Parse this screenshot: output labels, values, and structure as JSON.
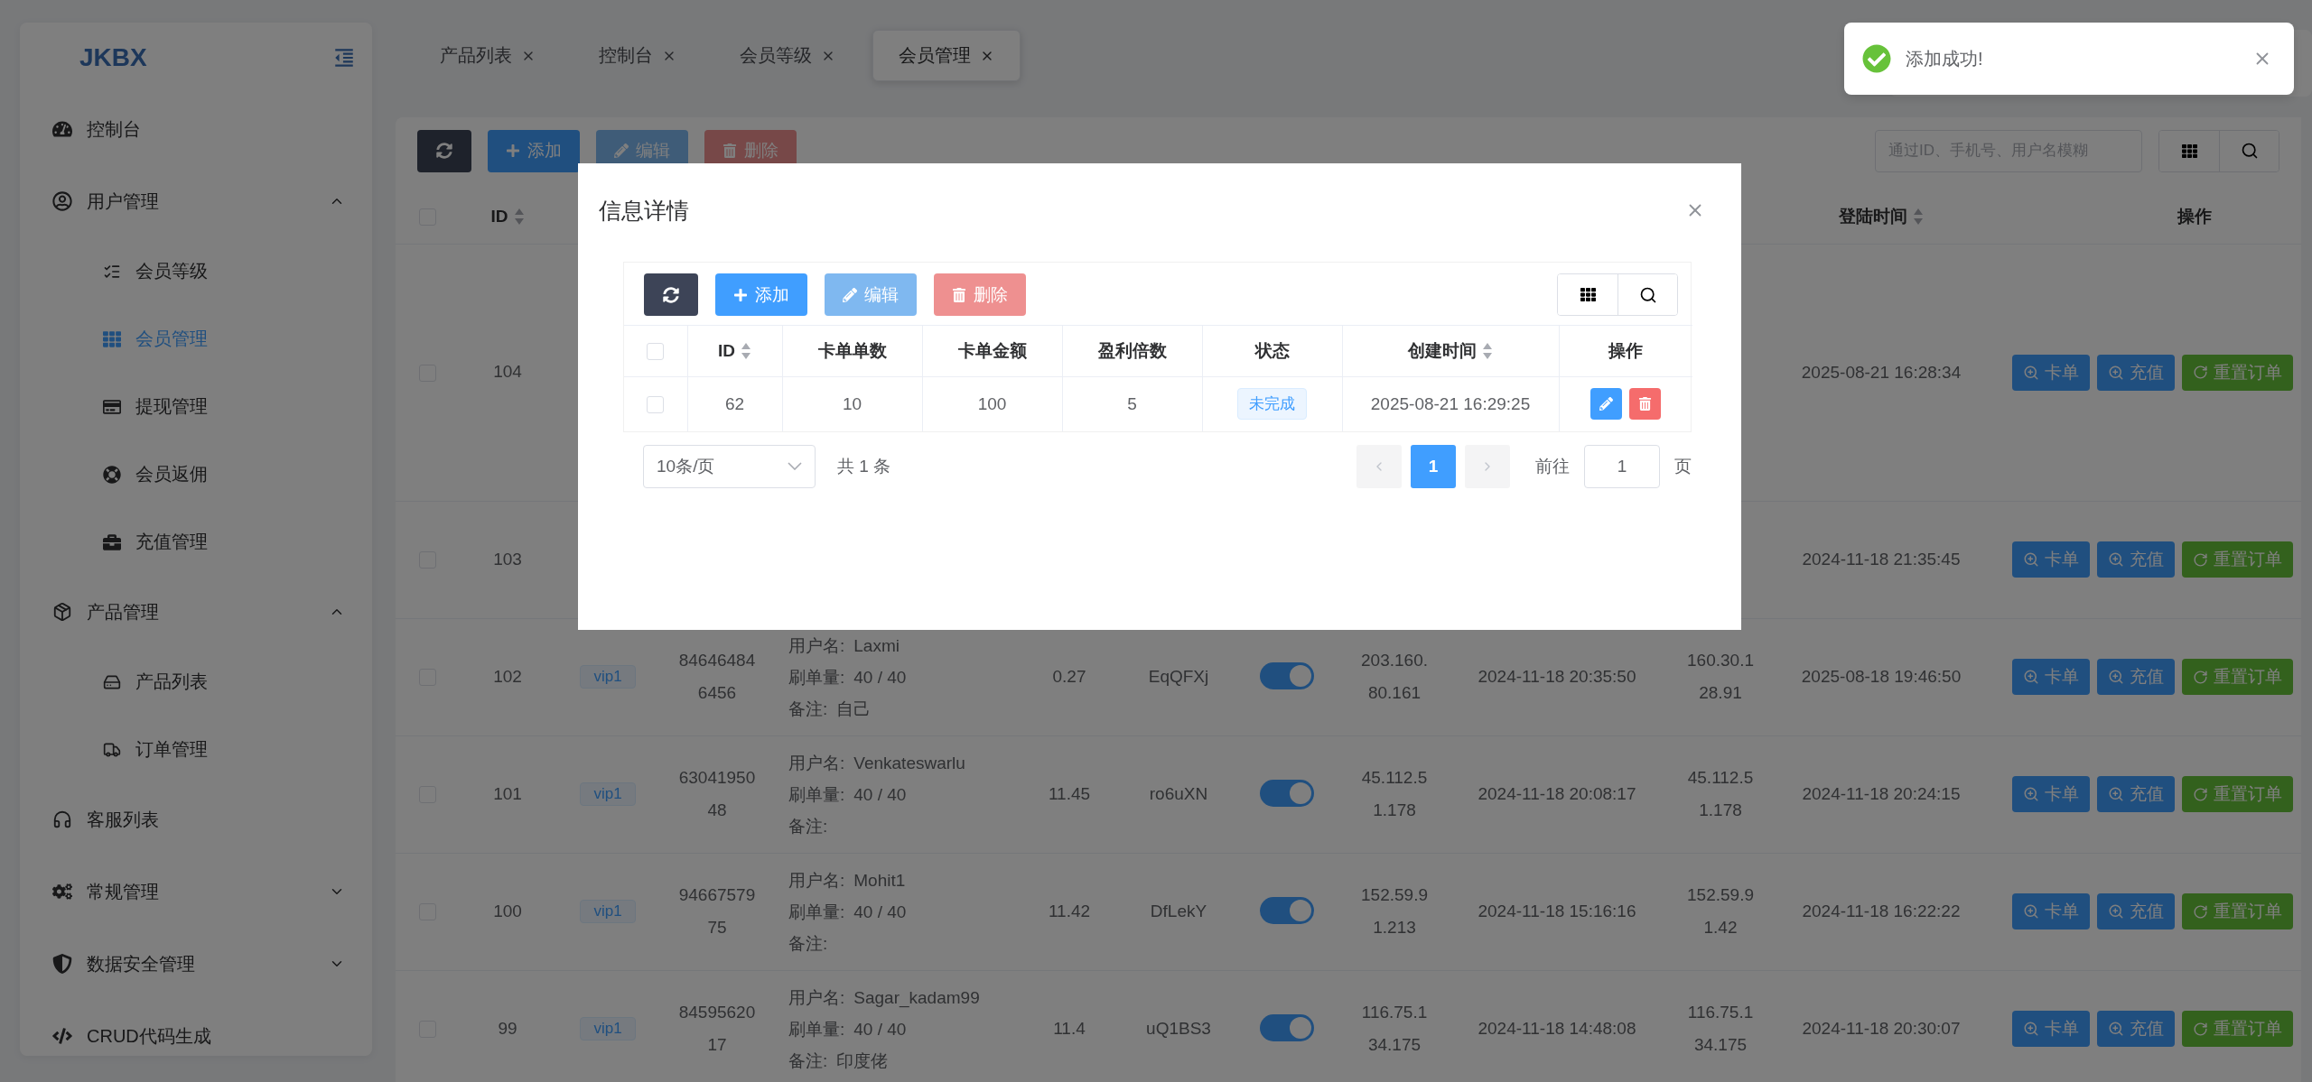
{
  "sidebar": {
    "logo": "JKBX",
    "menu": [
      {
        "label": "控制台",
        "selected": false
      },
      {
        "label": "用户管理",
        "expanded": true,
        "children": [
          {
            "label": "会员等级",
            "selected": false
          },
          {
            "label": "会员管理",
            "selected": true
          },
          {
            "label": "提现管理",
            "selected": false
          },
          {
            "label": "会员返佣",
            "selected": false
          },
          {
            "label": "充值管理",
            "selected": false
          }
        ]
      },
      {
        "label": "产品管理",
        "expanded": true,
        "children": [
          {
            "label": "产品列表",
            "selected": false
          },
          {
            "label": "订单管理",
            "selected": false
          }
        ]
      },
      {
        "label": "客服列表",
        "selected": false
      },
      {
        "label": "常规管理",
        "expanded": false
      },
      {
        "label": "数据安全管理",
        "expanded": false
      },
      {
        "label": "CRUD代码生成",
        "selected": false
      }
    ]
  },
  "tabs": [
    {
      "label": "产品列表",
      "selected": false
    },
    {
      "label": "控制台",
      "selected": false
    },
    {
      "label": "会员等级",
      "selected": false
    },
    {
      "label": "会员管理",
      "selected": true
    }
  ],
  "toolbar": {
    "buttons": [
      {
        "kind": "refresh",
        "disabled": false
      },
      {
        "kind": "add",
        "label": "添加",
        "disabled": false
      },
      {
        "kind": "edit",
        "label": "编辑",
        "disabled": true
      },
      {
        "kind": "delete",
        "label": "删除",
        "disabled": true
      }
    ],
    "search": {
      "placeholder": "通过ID、手机号、用户名模糊"
    }
  },
  "table": {
    "all_checked": false,
    "headers": {
      "id": {
        "label": "ID",
        "sortable": true
      },
      "login_time": {
        "label": "登陆时间",
        "sortable": true
      },
      "actions": {
        "label": "操作",
        "sortable": false
      }
    },
    "rows": [
      {
        "checked": false,
        "id": "104",
        "login_time": "2025-08-21 16:28:34",
        "actions": [
          {
            "kind": "view",
            "label": "卡单"
          },
          {
            "kind": "view",
            "label": "充值"
          },
          {
            "kind": "reset",
            "label": "重置订单"
          }
        ]
      },
      {
        "checked": false,
        "id": "103",
        "login_time": "2024-11-18 21:35:45",
        "actions": [
          {
            "kind": "view",
            "label": "卡单"
          },
          {
            "kind": "view",
            "label": "充值"
          },
          {
            "kind": "reset",
            "label": "重置订单"
          }
        ]
      },
      {
        "checked": false,
        "id": "102",
        "level": "vip1",
        "phone": "846464846456",
        "user": [
          {
            "label": "用户名:",
            "value": "Laxmi"
          },
          {
            "label": "刷单量:",
            "value": "40 / 40"
          },
          {
            "label": "备注:",
            "value": "自己"
          }
        ],
        "balance": "0.27",
        "code": "EqQFXj",
        "enabled": true,
        "reg_ip": "203.160.80.161",
        "reg_time": "2024-11-18 20:35:50",
        "last_ip": "160.30.128.91",
        "login_time": "2025-08-18 19:46:50",
        "actions": [
          {
            "kind": "view",
            "label": "卡单"
          },
          {
            "kind": "view",
            "label": "充值"
          },
          {
            "kind": "reset",
            "label": "重置订单"
          }
        ]
      },
      {
        "checked": false,
        "id": "101",
        "level": "vip1",
        "phone": "6304195048",
        "user": [
          {
            "label": "用户名:",
            "value": "Venkateswarlu"
          },
          {
            "label": "刷单量:",
            "value": "40 / 40"
          },
          {
            "label": "备注:"
          }
        ],
        "balance": "11.45",
        "code": "ro6uXN",
        "enabled": true,
        "reg_ip": "45.112.51.178",
        "reg_time": "2024-11-18 20:08:17",
        "last_ip": "45.112.51.178",
        "login_time": "2024-11-18 20:24:15",
        "actions": [
          {
            "kind": "view",
            "label": "卡单"
          },
          {
            "kind": "view",
            "label": "充值"
          },
          {
            "kind": "reset",
            "label": "重置订单"
          }
        ]
      },
      {
        "checked": false,
        "id": "100",
        "level": "vip1",
        "phone": "9466757975",
        "user": [
          {
            "label": "用户名:",
            "value": "Mohit1"
          },
          {
            "label": "刷单量:",
            "value": "40 / 40"
          },
          {
            "label": "备注:"
          }
        ],
        "balance": "11.42",
        "code": "DfLekY",
        "enabled": true,
        "reg_ip": "152.59.91.213",
        "reg_time": "2024-11-18 15:16:16",
        "last_ip": "152.59.91.42",
        "login_time": "2024-11-18 16:22:22",
        "actions": [
          {
            "kind": "view",
            "label": "卡单"
          },
          {
            "kind": "view",
            "label": "充值"
          },
          {
            "kind": "reset",
            "label": "重置订单"
          }
        ]
      },
      {
        "checked": false,
        "id": "99",
        "level": "vip1",
        "phone": "8459562017",
        "user": [
          {
            "label": "用户名:",
            "value": "Sagar_kadam99"
          },
          {
            "label": "刷单量:",
            "value": "40 / 40"
          },
          {
            "label": "备注:",
            "value": "印度佬"
          }
        ],
        "balance": "11.4",
        "code": "uQ1BS3",
        "enabled": true,
        "reg_ip": "116.75.134.175",
        "reg_time": "2024-11-18 14:48:08",
        "last_ip": "116.75.134.175",
        "login_time": "2024-11-18 20:30:07",
        "actions": [
          {
            "kind": "view",
            "label": "卡单"
          },
          {
            "kind": "view",
            "label": "充值"
          },
          {
            "kind": "reset",
            "label": "重置订单"
          }
        ]
      }
    ]
  },
  "modal": {
    "title": "信息详情",
    "buttons": [
      {
        "kind": "refresh",
        "disabled": false
      },
      {
        "kind": "add",
        "label": "添加",
        "disabled": false
      },
      {
        "kind": "edit",
        "label": "编辑",
        "disabled": true
      },
      {
        "kind": "delete",
        "label": "删除",
        "disabled": true
      }
    ],
    "all_checked": false,
    "columns": [
      {
        "label": "ID",
        "sortable": true
      },
      {
        "label": "卡单单数",
        "sortable": false
      },
      {
        "label": "卡单金额",
        "sortable": false
      },
      {
        "label": "盈利倍数",
        "sortable": false
      },
      {
        "label": "状态",
        "sortable": false
      },
      {
        "label": "创建时间",
        "sortable": true
      },
      {
        "label": "操作",
        "sortable": false
      }
    ],
    "rows": [
      {
        "checked": false,
        "cells": [
          "62",
          "10",
          "100",
          "5"
        ],
        "status": "未完成",
        "created": "2025-08-21 16:29:25"
      }
    ],
    "pagination": {
      "page_size": "10条/页",
      "total": "共 1 条",
      "pages": [
        {
          "label": "1",
          "selected": true
        }
      ],
      "goto": "前往",
      "page_input": "1",
      "page_unit": "页"
    }
  },
  "toast": {
    "message": "添加成功!"
  }
}
